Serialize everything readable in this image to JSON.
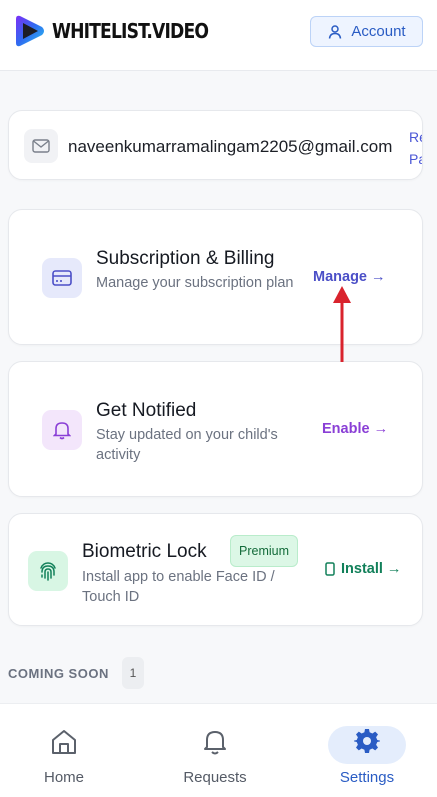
{
  "header": {
    "brand": "WHITELIST.VIDEO",
    "account_label": "Account"
  },
  "email_card": {
    "email": "naveenkumarramalingam2205@gmail.com",
    "reset_line1": "Re",
    "reset_line2": "Pass"
  },
  "subscription": {
    "title": "Subscription & Billing",
    "description": "Manage your subscription plan",
    "action": "Manage →",
    "icon": "credit-card-icon"
  },
  "notifications": {
    "title": "Get Notified",
    "description": "Stay updated on your child's activity",
    "action": "Enable →",
    "icon": "bell-icon"
  },
  "biometric": {
    "title": "Biometric Lock",
    "badge": "Premium",
    "description": "Install app to enable Face ID / Touch ID",
    "action": "Install →",
    "icon": "fingerprint-icon"
  },
  "coming_soon": {
    "label": "COMING SOON",
    "count": "1"
  },
  "bottom_nav": {
    "items": [
      {
        "label": "Home",
        "icon": "home-icon"
      },
      {
        "label": "Requests",
        "icon": "bell-icon"
      },
      {
        "label": "Settings",
        "icon": "gear-icon",
        "active": true
      }
    ]
  },
  "colors": {
    "accent_blue": "#2a5cc4",
    "manage_link": "#4b4fc7",
    "enable_link": "#8a3fd6",
    "install_link": "#12805a",
    "annotation_red": "#d9232d"
  }
}
